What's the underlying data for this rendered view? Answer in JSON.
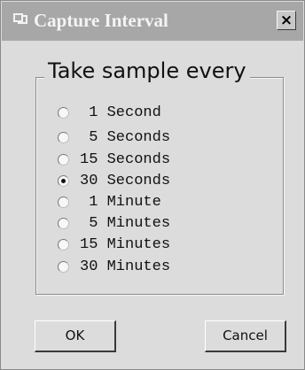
{
  "dialog": {
    "title": "Capture Interval",
    "close_label": "×"
  },
  "group": {
    "legend": "Take sample every"
  },
  "options": [
    {
      "label": " 1 Second",
      "checked": false
    },
    {
      "label": " 5 Seconds",
      "checked": false
    },
    {
      "label": "15 Seconds",
      "checked": false
    },
    {
      "label": "30 Seconds",
      "checked": true
    },
    {
      "label": " 1 Minute",
      "checked": false
    },
    {
      "label": " 5 Minutes",
      "checked": false
    },
    {
      "label": "15 Minutes",
      "checked": false
    },
    {
      "label": "30 Minutes",
      "checked": false
    }
  ],
  "buttons": {
    "ok_label": "OK",
    "cancel_label": "Cancel"
  }
}
